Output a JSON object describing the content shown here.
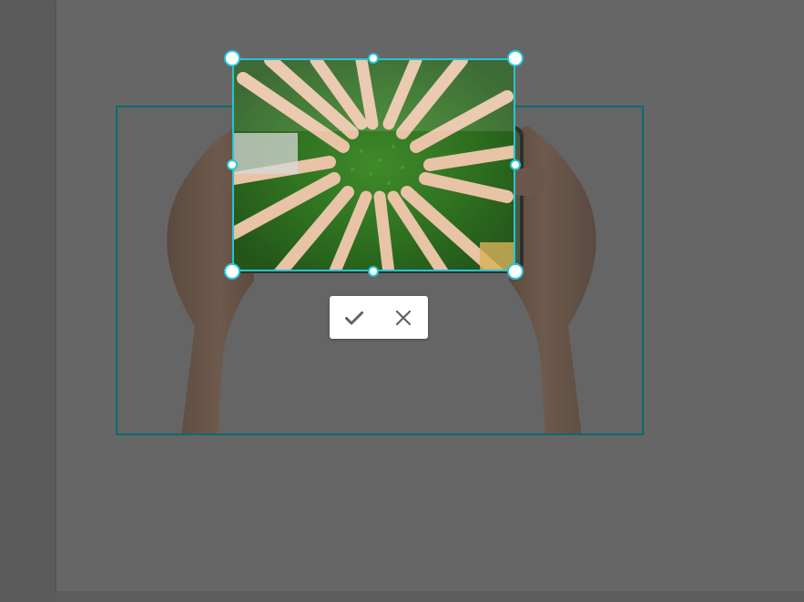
{
  "crop_toolbar": {
    "apply_label": "Apply crop",
    "apply_icon": "check-icon",
    "cancel_label": "Cancel crop",
    "cancel_icon": "close-icon"
  },
  "colors": {
    "backdrop": "#5c5c5c",
    "page": "#666666",
    "image_frame_border": "#0b6a72",
    "crop_border": "#27c4d4",
    "handle_fill": "#ffffff",
    "icon": "#5f6368"
  }
}
